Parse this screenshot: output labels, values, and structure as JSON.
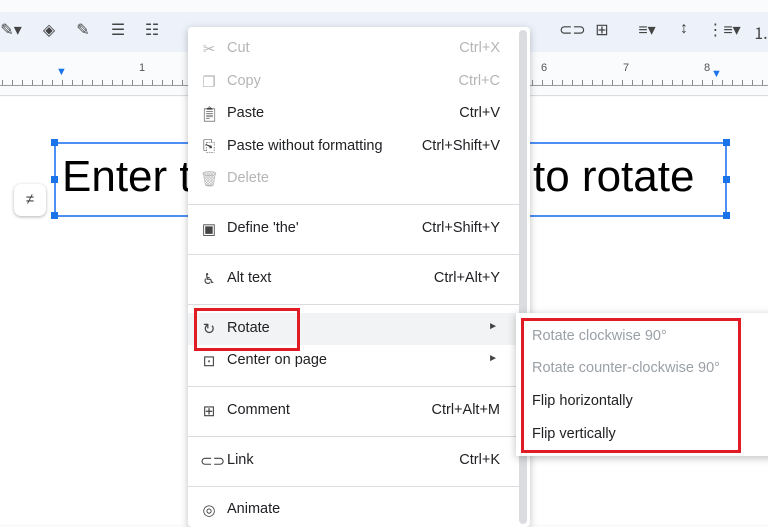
{
  "toolbar": {
    "icons": [
      "pen-icon",
      "fill-color-icon",
      "border-color-icon",
      "border-weight-icon",
      "border-dash-icon",
      "link-icon",
      "add-comment-icon",
      "align-icon",
      "line-spacing-icon",
      "bulleted-list-icon",
      "numbered-list-icon"
    ]
  },
  "ruler": {
    "numbers": [
      "1",
      "6",
      "7",
      "8"
    ]
  },
  "document": {
    "text_left": "Enter t",
    "text_right": "to rotate"
  },
  "context_menu": {
    "items": [
      {
        "label": "Cut",
        "shortcut": "Ctrl+X",
        "icon": "scissors-icon",
        "disabled": true
      },
      {
        "label": "Copy",
        "shortcut": "Ctrl+C",
        "icon": "copy-icon",
        "disabled": true
      },
      {
        "label": "Paste",
        "shortcut": "Ctrl+V",
        "icon": "clipboard-icon",
        "disabled": false
      },
      {
        "label": "Paste without formatting",
        "shortcut": "Ctrl+Shift+V",
        "icon": "clipboard-format-icon",
        "disabled": false
      },
      {
        "label": "Delete",
        "shortcut": "",
        "icon": "trash-icon",
        "disabled": true
      },
      {
        "label": "Define 'the'",
        "shortcut": "Ctrl+Shift+Y",
        "icon": "dictionary-icon",
        "disabled": false
      },
      {
        "label": "Alt text",
        "shortcut": "Ctrl+Alt+Y",
        "icon": "accessibility-icon",
        "disabled": false
      },
      {
        "label": "Rotate",
        "shortcut": "",
        "icon": "rotate-icon",
        "disabled": false
      },
      {
        "label": "Center on page",
        "shortcut": "",
        "icon": "center-icon",
        "disabled": false
      },
      {
        "label": "Comment",
        "shortcut": "Ctrl+Alt+M",
        "icon": "add-comment-icon",
        "disabled": false
      },
      {
        "label": "Link",
        "shortcut": "Ctrl+K",
        "icon": "link-icon",
        "disabled": false
      },
      {
        "label": "Animate",
        "shortcut": "",
        "icon": "animate-icon",
        "disabled": false
      }
    ]
  },
  "rotate_submenu": {
    "items": [
      {
        "label": "Rotate clockwise 90°",
        "disabled": true
      },
      {
        "label": "Rotate counter-clockwise 90°",
        "disabled": true
      },
      {
        "label": "Flip horizontally",
        "disabled": false
      },
      {
        "label": "Flip vertically",
        "disabled": false
      }
    ]
  },
  "colors": {
    "highlight": "#e01b24",
    "selection": "#1a73e8"
  }
}
